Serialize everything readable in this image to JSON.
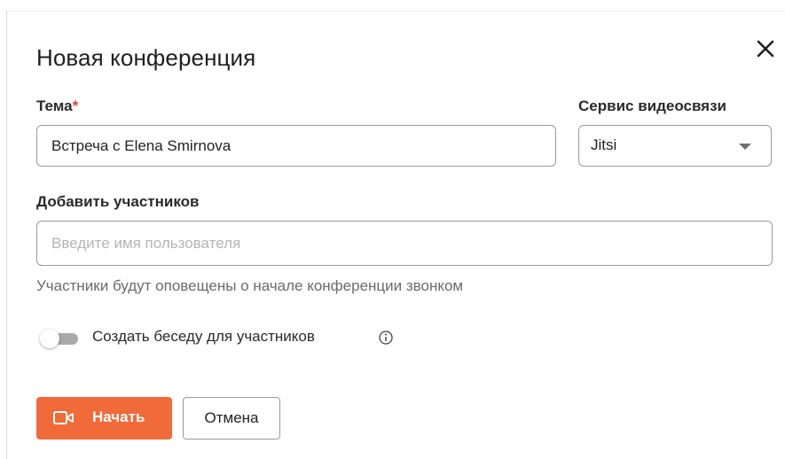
{
  "dialog": {
    "title": "Новая конференция",
    "close_icon": "close-icon"
  },
  "topic": {
    "label": "Тема",
    "required_mark": "*",
    "value": "Встреча с Elena Smirnova"
  },
  "service": {
    "label": "Сервис видеосвязи",
    "selected": "Jitsi",
    "caret_icon": "chevron-down-icon"
  },
  "participants": {
    "label": "Добавить участников",
    "placeholder": "Введите имя пользователя",
    "hint": "Участники будут оповещены о начале конференции звонком"
  },
  "chat_toggle": {
    "label": "Создать беседу для участников",
    "enabled": false,
    "info_icon": "info-icon"
  },
  "actions": {
    "start_label": "Начать",
    "start_icon": "video-camera-icon",
    "cancel_label": "Отмена"
  },
  "colors": {
    "accent": "#f06a3a",
    "required": "#e0432b",
    "border": "#9a9a9a",
    "hint_text": "#6b6b6b"
  }
}
